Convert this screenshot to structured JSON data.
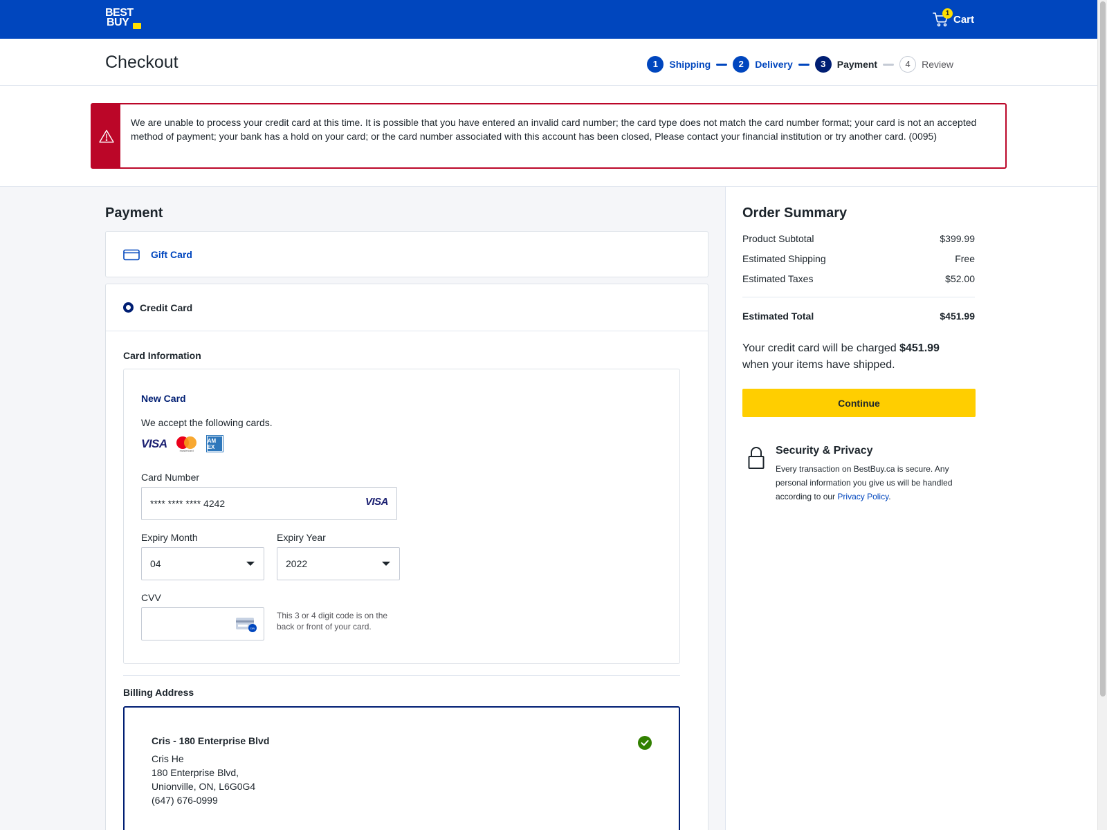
{
  "header": {
    "logo_line1": "BEST",
    "logo_line2": "BUY",
    "cart_count": "1",
    "cart_label": "Cart",
    "brand_color": "#0046be",
    "accent_color": "#ffe000"
  },
  "checkout": {
    "title": "Checkout",
    "steps": [
      {
        "num": "1",
        "label": "Shipping",
        "state": "done"
      },
      {
        "num": "2",
        "label": "Delivery",
        "state": "done"
      },
      {
        "num": "3",
        "label": "Payment",
        "state": "active"
      },
      {
        "num": "4",
        "label": "Review",
        "state": "todo"
      }
    ]
  },
  "error": {
    "icon": "warning-icon",
    "message": "We are unable to process your credit card at this time. It is possible that you have entered an invalid card number; the card type does not match the card number format; your card is not an accepted method of payment; your bank has a hold on your card; or the card number associated with this account has been closed, Please contact your financial institution or try another card. (0095)",
    "color": "#bb0628"
  },
  "payment": {
    "title": "Payment",
    "gift_card_label": "Gift Card",
    "credit_card_label": "Credit Card",
    "card_info_label": "Card Information",
    "new_card_title": "New Card",
    "accept_text": "We accept the following cards.",
    "card_brands": {
      "visa": "VISA",
      "mastercard": "mastercard",
      "amex": "AM EX"
    },
    "card_number_label": "Card Number",
    "card_number_value": "**** **** **** 4242",
    "card_number_brand": "VISA",
    "expiry_month_label": "Expiry Month",
    "expiry_month_value": "04",
    "expiry_year_label": "Expiry Year",
    "expiry_year_value": "2022",
    "cvv_label": "CVV",
    "cvv_value": "",
    "cvv_help": "This 3 or 4 digit code is on the back or front of your card.",
    "billing_label": "Billing Address",
    "billing": {
      "name": "Cris - 180 Enterprise Blvd",
      "person": "Cris He",
      "street": "180 Enterprise Blvd,",
      "city": "Unionville, ON, L6G0G4",
      "phone": "(647) 676-0999"
    }
  },
  "summary": {
    "title": "Order Summary",
    "rows": [
      {
        "label": "Product Subtotal",
        "value": "$399.99"
      },
      {
        "label": "Estimated Shipping",
        "value": "Free"
      },
      {
        "label": "Estimated Taxes",
        "value": "$52.00"
      }
    ],
    "total_label": "Estimated Total",
    "total_value": "$451.99",
    "charge_prefix": "Your credit card will be charged",
    "charge_amount": "$451.99",
    "charge_suffix": "when your items have shipped.",
    "continue_label": "Continue",
    "security_title": "Security & Privacy",
    "security_text": "Every transaction on BestBuy.ca is secure. Any personal information you give us will be handled according to our",
    "privacy_link": "Privacy Policy",
    "privacy_period": "."
  }
}
